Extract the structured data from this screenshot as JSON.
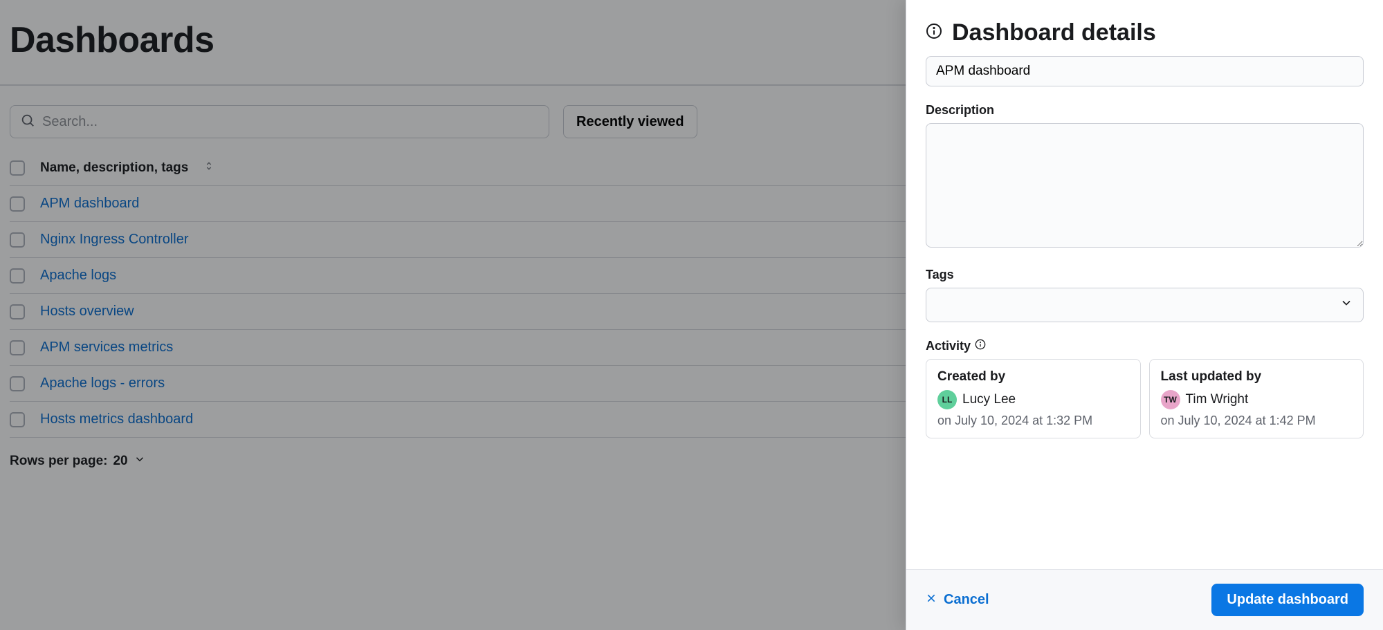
{
  "page": {
    "title": "Dashboards",
    "search_placeholder": "Search...",
    "recent_label": "Recently viewed",
    "column_header": "Name, description, tags",
    "rows_per_page_label": "Rows per page:",
    "rows_per_page_value": "20",
    "items": [
      {
        "name": "APM dashboard"
      },
      {
        "name": "Nginx Ingress Controller"
      },
      {
        "name": "Apache logs"
      },
      {
        "name": "Hosts overview"
      },
      {
        "name": "APM services metrics"
      },
      {
        "name": "Apache logs - errors"
      },
      {
        "name": "Hosts metrics dashboard"
      }
    ]
  },
  "panel": {
    "title": "Dashboard details",
    "name_value": "APM dashboard",
    "description_label": "Description",
    "description_value": "",
    "tags_label": "Tags",
    "activity_label": "Activity",
    "created_by_label": "Created by",
    "created_by_user": "Lucy Lee",
    "created_by_initials": "LL",
    "created_by_date": "on July 10, 2024 at 1:32 PM",
    "updated_by_label": "Last updated by",
    "updated_by_user": "Tim Wright",
    "updated_by_initials": "TW",
    "updated_by_date": "on July 10, 2024 at 1:42 PM",
    "cancel_label": "Cancel",
    "save_label": "Update dashboard"
  }
}
